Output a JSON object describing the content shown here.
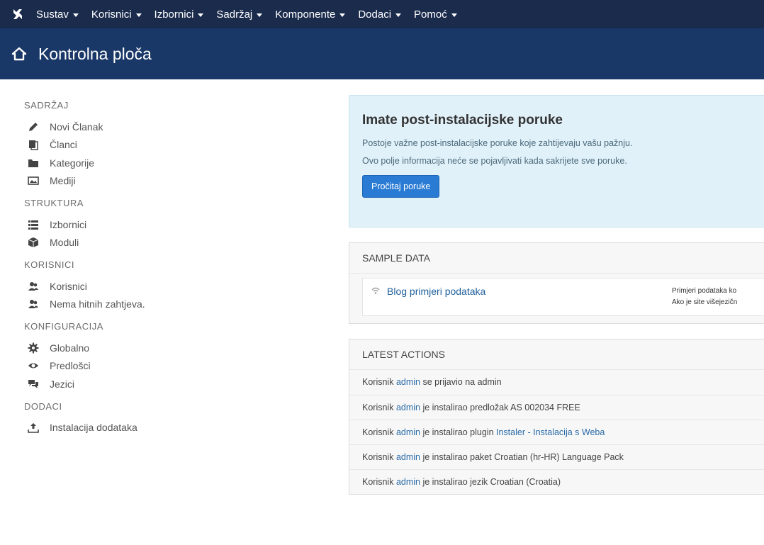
{
  "topnav": {
    "items": [
      {
        "label": "Sustav"
      },
      {
        "label": "Korisnici"
      },
      {
        "label": "Izbornici"
      },
      {
        "label": "Sadržaj"
      },
      {
        "label": "Komponente"
      },
      {
        "label": "Dodaci"
      },
      {
        "label": "Pomoć"
      }
    ]
  },
  "header": {
    "title": "Kontrolna ploča"
  },
  "sidebar": {
    "sections": [
      {
        "heading": "SADRŽAJ",
        "items": [
          {
            "label": "Novi Članak",
            "icon": "pencil-icon"
          },
          {
            "label": "Članci",
            "icon": "stack-icon"
          },
          {
            "label": "Kategorije",
            "icon": "folder-icon"
          },
          {
            "label": "Mediji",
            "icon": "image-icon"
          }
        ]
      },
      {
        "heading": "STRUKTURA",
        "items": [
          {
            "label": "Izbornici",
            "icon": "list-icon"
          },
          {
            "label": "Moduli",
            "icon": "cube-icon"
          }
        ]
      },
      {
        "heading": "KORISNICI",
        "items": [
          {
            "label": "Korisnici",
            "icon": "users-icon"
          },
          {
            "label": "Nema hitnih zahtjeva.",
            "icon": "users-icon"
          }
        ]
      },
      {
        "heading": "KONFIGURACIJA",
        "items": [
          {
            "label": "Globalno",
            "icon": "cog-icon"
          },
          {
            "label": "Predlošci",
            "icon": "eye-icon"
          },
          {
            "label": "Jezici",
            "icon": "comments-icon"
          }
        ]
      },
      {
        "heading": "DODACI",
        "items": [
          {
            "label": "Instalacija dodataka",
            "icon": "upload-icon"
          }
        ]
      }
    ]
  },
  "alert": {
    "title": "Imate post-instalacijske poruke",
    "line1": "Postoje važne post-instalacijske poruke koje zahtijevaju vašu pažnju.",
    "line2": "Ovo polje informacija neće se pojavljivati kada sakrijete sve poruke.",
    "button_label": "Pročitaj poruke"
  },
  "sample_data": {
    "heading": "SAMPLE DATA",
    "link_label": "Blog primjeri podataka",
    "desc_line1": "Primjeri podataka ko",
    "desc_line2": "Ako je site višejezičn"
  },
  "latest_actions": {
    "heading": "LATEST ACTIONS",
    "rows": [
      {
        "prefix": "Korisnik ",
        "user": "admin",
        "text": " se prijavio na admin",
        "target": ""
      },
      {
        "prefix": "Korisnik ",
        "user": "admin",
        "text": " je instalirao predložak AS 002034 FREE",
        "target": ""
      },
      {
        "prefix": "Korisnik ",
        "user": "admin",
        "text": " je instalirao plugin ",
        "target": "Instaler - Instalacija s Weba"
      },
      {
        "prefix": "Korisnik ",
        "user": "admin",
        "text": " je instalirao paket Croatian (hr-HR) Language Pack",
        "target": ""
      },
      {
        "prefix": "Korisnik ",
        "user": "admin",
        "text": " je instalirao jezik Croatian (Croatia)",
        "target": ""
      }
    ]
  },
  "colors": {
    "topbar": "#1a2b4c",
    "titlebar": "#1a3867",
    "alert_bg": "#e1f1f9",
    "button": "#2a7bd4",
    "link": "#2a6ba8"
  }
}
